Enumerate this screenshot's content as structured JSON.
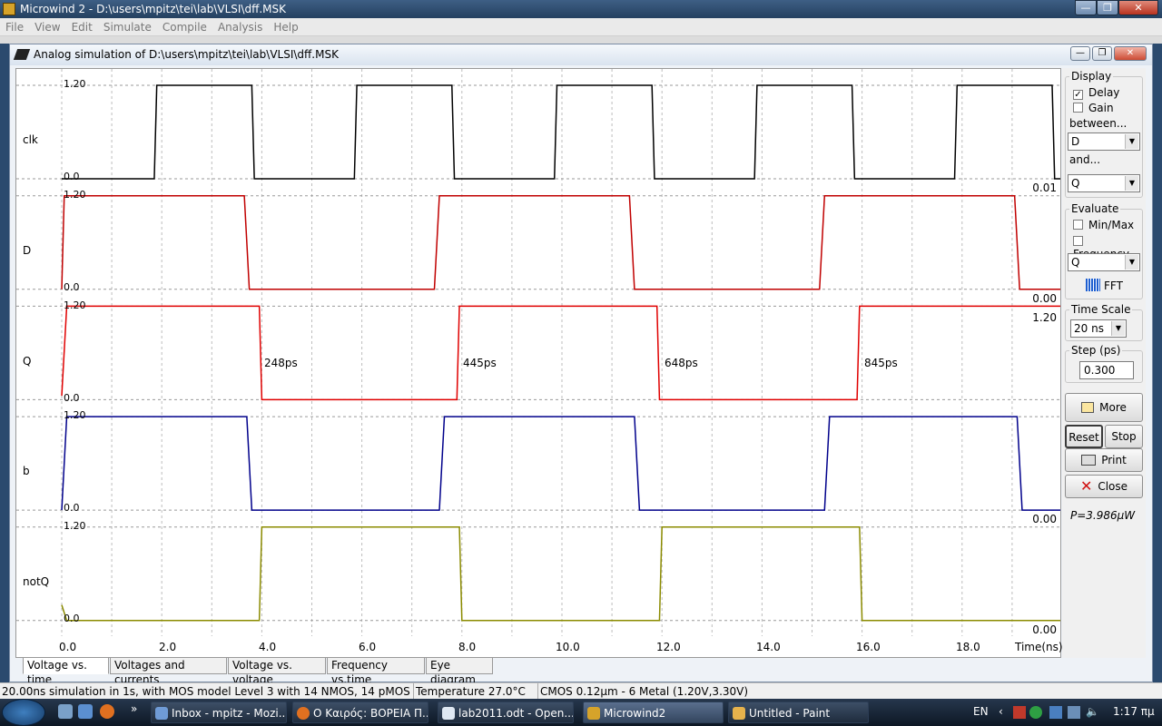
{
  "window": {
    "title": "Microwind 2 - D:\\users\\mpitz\\tei\\lab\\VLSI\\dff.MSK",
    "minimize": "—",
    "restore": "❐",
    "close": "✕"
  },
  "menu": [
    "File",
    "View",
    "Edit",
    "Simulate",
    "Compile",
    "Analysis",
    "Help"
  ],
  "child": {
    "title": "Analog simulation of D:\\users\\mpitz\\tei\\lab\\VLSI\\dff.MSK"
  },
  "signals": [
    {
      "name": "clk",
      "ymax": "1.20",
      "ymin": "0.0",
      "right": "0.01",
      "color": "#000000"
    },
    {
      "name": "D",
      "ymax": "1.20",
      "ymin": "0.0",
      "right": "0.00",
      "color": "#c00000"
    },
    {
      "name": "Q",
      "ymax": "1.20",
      "ymin": "0.0",
      "right": "1.20",
      "color": "#e00000"
    },
    {
      "name": "b",
      "ymax": "1.20",
      "ymin": "0.0",
      "right": "0.00",
      "color": "#00008b"
    },
    {
      "name": "notQ",
      "ymax": "1.20",
      "ymin": "0.0",
      "right": "0.00",
      "color": "#8b8b00"
    }
  ],
  "delays": [
    "248ps",
    "445ps",
    "648ps",
    "845ps"
  ],
  "xaxis": {
    "ticks": [
      "0.0",
      "2.0",
      "4.0",
      "6.0",
      "8.0",
      "10.0",
      "12.0",
      "14.0",
      "16.0",
      "18.0"
    ],
    "label": "Time(ns)",
    "range": [
      0,
      20
    ]
  },
  "waves": {
    "clk": [
      [
        0,
        0
      ],
      [
        1.85,
        0
      ],
      [
        1.9,
        1.2
      ],
      [
        3.8,
        1.2
      ],
      [
        3.85,
        0
      ],
      [
        5.85,
        0
      ],
      [
        5.9,
        1.2
      ],
      [
        7.8,
        1.2
      ],
      [
        7.85,
        0
      ],
      [
        9.85,
        0
      ],
      [
        9.9,
        1.2
      ],
      [
        11.8,
        1.2
      ],
      [
        11.85,
        0
      ],
      [
        13.85,
        0
      ],
      [
        13.9,
        1.2
      ],
      [
        15.8,
        1.2
      ],
      [
        15.85,
        0
      ],
      [
        17.85,
        0
      ],
      [
        17.9,
        1.2
      ],
      [
        19.8,
        1.2
      ],
      [
        19.85,
        0
      ],
      [
        20,
        0
      ]
    ],
    "D": [
      [
        0,
        0
      ],
      [
        0.05,
        1.2
      ],
      [
        3.65,
        1.2
      ],
      [
        3.75,
        0
      ],
      [
        7.45,
        0
      ],
      [
        7.55,
        1.2
      ],
      [
        11.35,
        1.2
      ],
      [
        11.45,
        0
      ],
      [
        15.15,
        0
      ],
      [
        15.25,
        1.2
      ],
      [
        19.05,
        1.2
      ],
      [
        19.15,
        0
      ],
      [
        20,
        0
      ]
    ],
    "Q": [
      [
        0,
        0.05
      ],
      [
        0.1,
        1.2
      ],
      [
        3.95,
        1.2
      ],
      [
        4.0,
        0
      ],
      [
        7.9,
        0
      ],
      [
        7.95,
        1.2
      ],
      [
        11.9,
        1.2
      ],
      [
        11.95,
        0
      ],
      [
        15.9,
        0
      ],
      [
        15.95,
        1.2
      ],
      [
        20,
        1.2
      ]
    ],
    "b": [
      [
        0,
        0
      ],
      [
        0.1,
        1.2
      ],
      [
        3.7,
        1.2
      ],
      [
        3.8,
        0
      ],
      [
        7.55,
        0
      ],
      [
        7.65,
        1.2
      ],
      [
        11.45,
        1.2
      ],
      [
        11.55,
        0
      ],
      [
        15.25,
        0
      ],
      [
        15.35,
        1.2
      ],
      [
        19.1,
        1.2
      ],
      [
        19.2,
        0
      ],
      [
        20,
        0
      ]
    ],
    "notQ": [
      [
        0,
        0.2
      ],
      [
        0.1,
        0
      ],
      [
        3.95,
        0
      ],
      [
        4.0,
        1.2
      ],
      [
        7.95,
        1.2
      ],
      [
        8.0,
        0
      ],
      [
        11.95,
        0
      ],
      [
        12.0,
        1.2
      ],
      [
        15.95,
        1.2
      ],
      [
        16.0,
        0
      ],
      [
        20,
        0
      ]
    ]
  },
  "panel": {
    "display": "Display",
    "delay": "Delay",
    "gain": "Gain",
    "between": "between...",
    "between_sel": "D",
    "and": "and...",
    "and_sel": "Q",
    "evaluate": "Evaluate",
    "minmax": "Min/Max",
    "frequency": "Frequency",
    "eval_sel": "Q",
    "fft": "FFT",
    "timescale": "Time Scale",
    "timescale_val": "20 ns",
    "step": "Step (ps)",
    "step_val": "0.300",
    "more": "More",
    "reset": "Reset",
    "stop": "Stop",
    "print": "Print",
    "close": "Close",
    "power": "P=3.986µW"
  },
  "tabs": [
    "Voltage vs. time",
    "Voltages and currents",
    "Voltage vs. voltage",
    "Frequency vs.time",
    "Eye diagram"
  ],
  "status": [
    "20.00ns simulation in 1s, with MOS model Level 3 with 14 NMOS, 14 pMOS",
    "Temperature 27.0°C",
    "CMOS 0.12µm - 6 Metal (1.20V,3.30V)"
  ],
  "taskbar": {
    "items": [
      "Inbox - mpitz - Mozi...",
      "Ο Καιρός: ΒΟΡΕΙΑ Π...",
      "lab2011.odt - Open...",
      "Microwind2",
      "Untitled - Paint"
    ],
    "lang": "EN",
    "time": "1:17 πμ",
    "chevron": "»"
  }
}
